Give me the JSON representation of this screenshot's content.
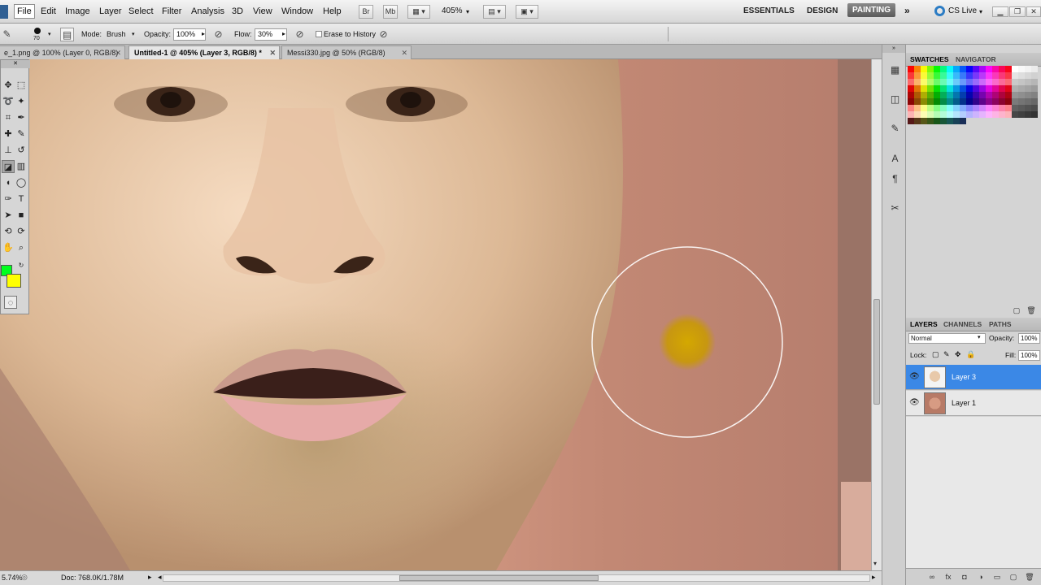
{
  "menubar": {
    "app_logo": "Ps",
    "items": [
      "File",
      "Edit",
      "Image",
      "Layer",
      "Select",
      "Filter",
      "Analysis",
      "3D",
      "View",
      "Window",
      "Help"
    ],
    "zoom": "405%",
    "workspaces": [
      "ESSENTIALS",
      "DESIGN",
      "PAINTING"
    ],
    "cs_live": "CS Live"
  },
  "options": {
    "brush_size": "70",
    "mode_label": "Mode:",
    "mode_value": "Brush",
    "opacity_label": "Opacity:",
    "opacity_value": "100%",
    "flow_label": "Flow:",
    "flow_value": "30%",
    "erase_history": "Erase to History"
  },
  "tabs": [
    {
      "label": "e_1.png @ 100% (Layer 0, RGB/8)"
    },
    {
      "label": "Untitled-1 @ 405% (Layer 3, RGB/8) *"
    },
    {
      "label": "Messi330.jpg @ 50% (RGB/8)"
    }
  ],
  "status": {
    "zoom": "5.74%",
    "doc": "Doc: 768.0K/1.78M"
  },
  "panels": {
    "swatch_tabs": [
      "SWATCHES",
      "NAVIGATOR"
    ],
    "layer_tabs": [
      "LAYERS",
      "CHANNELS",
      "PATHS"
    ],
    "blend_mode": "Normal",
    "opacity_label": "Opacity:",
    "opacity_value": "100%",
    "lock_label": "Lock:",
    "fill_label": "Fill:",
    "fill_value": "100%",
    "layers": [
      {
        "name": "Layer 3",
        "selected": true
      },
      {
        "name": "Layer 1",
        "selected": false
      }
    ]
  },
  "colors": {
    "foreground": "#00ff1e",
    "background": "#ffff00",
    "selection": "#3b88e6"
  }
}
